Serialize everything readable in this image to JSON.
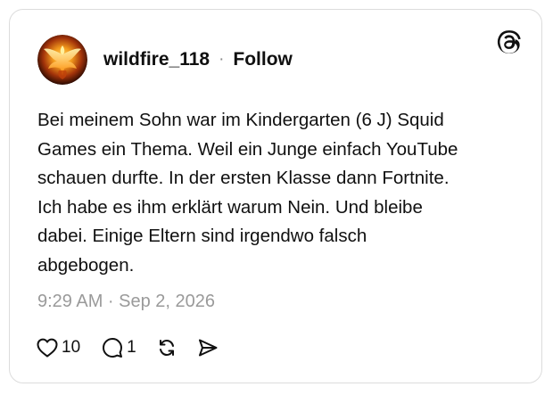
{
  "post": {
    "username": "wildfire_118",
    "separator": "·",
    "follow_label": "Follow",
    "text": "Bei meinem Sohn war im Kindergarten (6 J) Squid\nGames ein Thema. Weil ein Junge einfach YouTube\nschauen durfte. In der ersten Klasse dann Fortnite.\nIch habe es ihm erklärt warum Nein. Und bleibe\ndabei. Einige Eltern sind irgendwo falsch\nabgebogen.",
    "timestamp": "9:29 AM · Sep 2, 2026",
    "likes": "10",
    "replies": "1"
  },
  "icons": {
    "brand": "threads-logo-icon",
    "like": "heart-icon",
    "reply": "comment-bubble-icon",
    "repost": "repost-arrows-icon",
    "share": "send-icon"
  },
  "colors": {
    "text": "#101010",
    "muted": "#9a9a9a",
    "border": "#dcdcdc",
    "background": "#ffffff"
  }
}
